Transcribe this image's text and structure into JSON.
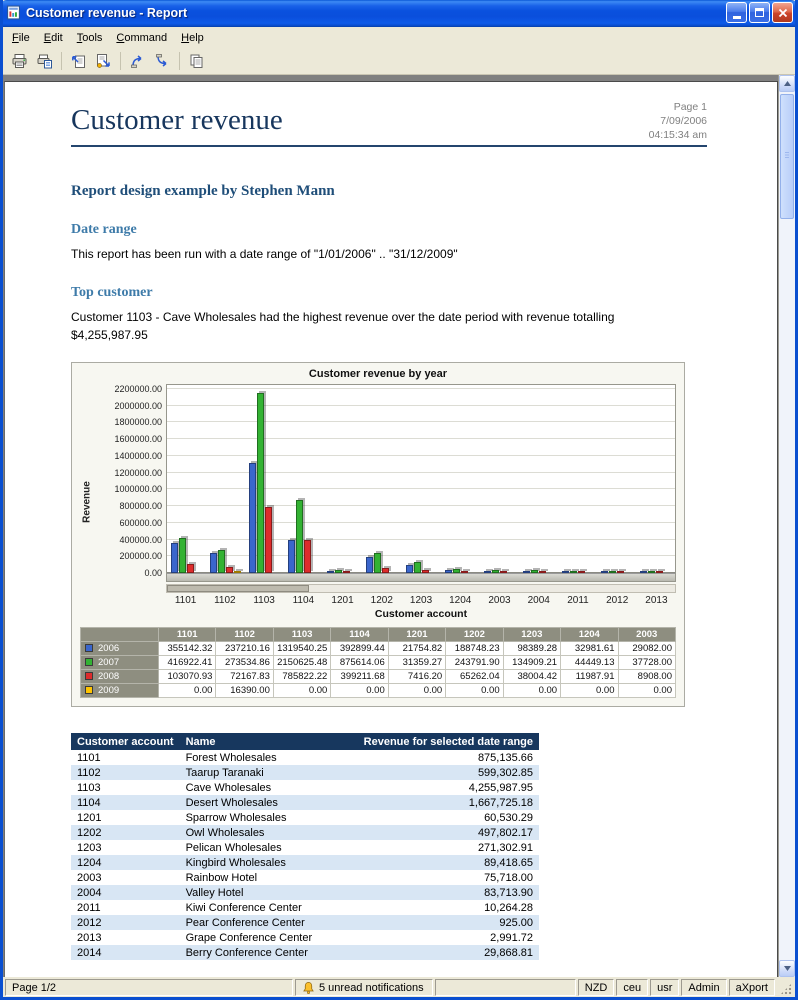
{
  "window": {
    "title": "Customer revenue - Report"
  },
  "menu": {
    "items": [
      {
        "label": "File"
      },
      {
        "label": "Edit"
      },
      {
        "label": "Tools"
      },
      {
        "label": "Command"
      },
      {
        "label": "Help"
      }
    ]
  },
  "toolbar": {
    "buttons": [
      {
        "name": "print-button",
        "icon": "printer-icon"
      },
      {
        "name": "print-report-button",
        "icon": "print-report-icon"
      },
      {
        "name": "export-page-button",
        "icon": "export-up-icon"
      },
      {
        "name": "export-report-button",
        "icon": "export-run-icon"
      },
      {
        "name": "nav-up-button",
        "icon": "arrow-up-icon"
      },
      {
        "name": "nav-down-button",
        "icon": "arrow-down-icon"
      },
      {
        "name": "copy-button",
        "icon": "copy-icon"
      }
    ]
  },
  "report": {
    "page_label": "Page 1",
    "date": "7/09/2006",
    "time": "04:15:34 am",
    "title": "Customer revenue",
    "heading": "Report design example by Stephen Mann",
    "sections": [
      {
        "heading": "Date range",
        "body": "This report has been run with a date range of \"1/01/2006\" .. \"31/12/2009\""
      },
      {
        "heading": "Top customer",
        "body": "Customer 1103 - Cave Wholesales had the highest revenue over the date period with revenue totalling $4,255,987.95"
      }
    ]
  },
  "chart_data": {
    "type": "bar",
    "title": "Customer revenue by year",
    "xlabel": "Customer account",
    "ylabel": "Revenue",
    "ylim": [
      0,
      2200000
    ],
    "ytick_step": 200000,
    "grid": true,
    "legend_position": "table-below",
    "ytick_labels": [
      "2200000.00",
      "2000000.00",
      "1800000.00",
      "1600000.00",
      "1400000.00",
      "1200000.00",
      "1000000.00",
      "800000.00",
      "600000.00",
      "400000.00",
      "200000.00",
      "0.00"
    ],
    "categories": [
      "1101",
      "1102",
      "1103",
      "1104",
      "1201",
      "1202",
      "1203",
      "1204",
      "2003",
      "2004",
      "2011",
      "2012",
      "2013"
    ],
    "series": [
      {
        "name": "2006",
        "color": "#3A66CC",
        "values": [
          355142.32,
          237210.16,
          1319540.25,
          392899.44,
          21754.82,
          188748.23,
          98389.28,
          32981.61,
          29082.0,
          29300,
          3600,
          320,
          1050
        ]
      },
      {
        "name": "2007",
        "color": "#33B233",
        "values": [
          416922.41,
          273534.86,
          2150625.48,
          875614.06,
          31359.27,
          243791.9,
          134909.21,
          44449.13,
          37728.0,
          40100,
          4900,
          440,
          1400
        ]
      },
      {
        "name": "2008",
        "color": "#DD2C2C",
        "values": [
          103070.93,
          72167.83,
          785822.22,
          399211.68,
          7416.2,
          65262.04,
          38004.42,
          11987.91,
          8908.0,
          11600,
          1400,
          125,
          420
        ]
      },
      {
        "name": "2009",
        "color": "#FFC400",
        "values": [
          0,
          16390.0,
          0,
          0,
          0,
          0,
          0,
          0,
          0,
          0,
          0,
          0,
          0
        ]
      }
    ],
    "table": {
      "columns": [
        "1101",
        "1102",
        "1103",
        "1104",
        "1201",
        "1202",
        "1203",
        "1204",
        "2003"
      ],
      "rows": [
        {
          "name": "2006",
          "values": [
            "355142.32",
            "237210.16",
            "1319540.25",
            "392899.44",
            "21754.82",
            "188748.23",
            "98389.28",
            "32981.61",
            "29082.00"
          ]
        },
        {
          "name": "2007",
          "values": [
            "416922.41",
            "273534.86",
            "2150625.48",
            "875614.06",
            "31359.27",
            "243791.90",
            "134909.21",
            "44449.13",
            "37728.00"
          ]
        },
        {
          "name": "2008",
          "values": [
            "103070.93",
            "72167.83",
            "785822.22",
            "399211.68",
            "7416.20",
            "65262.04",
            "38004.42",
            "11987.91",
            "8908.00"
          ]
        },
        {
          "name": "2009",
          "values": [
            "0.00",
            "16390.00",
            "0.00",
            "0.00",
            "0.00",
            "0.00",
            "0.00",
            "0.00",
            "0.00"
          ]
        }
      ]
    }
  },
  "customer_table": {
    "headers": [
      "Customer account",
      "Name",
      "Revenue for selected date range"
    ],
    "rows": [
      [
        "1101",
        "Forest Wholesales",
        "875,135.66"
      ],
      [
        "1102",
        "Taarup Taranaki",
        "599,302.85"
      ],
      [
        "1103",
        "Cave Wholesales",
        "4,255,987.95"
      ],
      [
        "1104",
        "Desert Wholesales",
        "1,667,725.18"
      ],
      [
        "1201",
        "Sparrow Wholesales",
        "60,530.29"
      ],
      [
        "1202",
        "Owl Wholesales",
        "497,802.17"
      ],
      [
        "1203",
        "Pelican Wholesales",
        "271,302.91"
      ],
      [
        "1204",
        "Kingbird Wholesales",
        "89,418.65"
      ],
      [
        "2003",
        "Rainbow Hotel",
        "75,718.00"
      ],
      [
        "2004",
        "Valley Hotel",
        "83,713.90"
      ],
      [
        "2011",
        "Kiwi Conference Center",
        "10,264.28"
      ],
      [
        "2012",
        "Pear Conference Center",
        "925.00"
      ],
      [
        "2013",
        "Grape Conference Center",
        "2,991.72"
      ],
      [
        "2014",
        "Berry Conference Center",
        "29,868.81"
      ]
    ]
  },
  "status_bar": {
    "page": "Page 1/2",
    "notifications": "5 unread notifications",
    "panels": [
      "NZD",
      "ceu",
      "usr",
      "Admin",
      "aXport"
    ]
  }
}
